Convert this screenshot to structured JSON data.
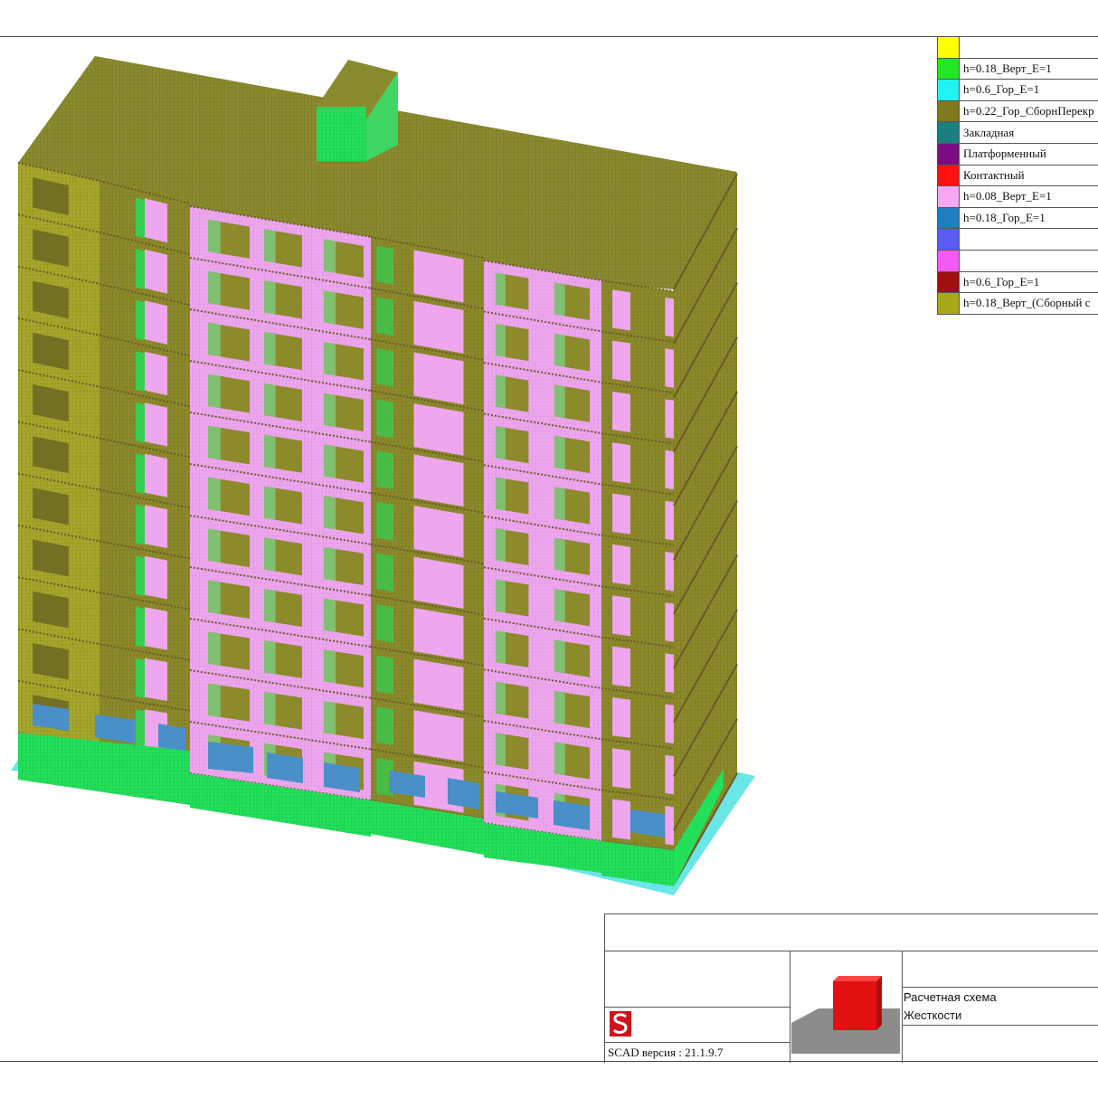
{
  "legend": {
    "items": [
      {
        "color": "#ffff00",
        "label": ""
      },
      {
        "color": "#22e822",
        "label": "h=0.18_Верт_E=1"
      },
      {
        "color": "#22f2f2",
        "label": "h=0.6_Гор_E=1"
      },
      {
        "color": "#807a1e",
        "label": "h=0.22_Гор_СборнПерекр"
      },
      {
        "color": "#1a7f80",
        "label": "Закладная"
      },
      {
        "color": "#7a0d82",
        "label": "Платформенный"
      },
      {
        "color": "#ff1111",
        "label": "Контактный"
      },
      {
        "color": "#f4a8f4",
        "label": "h=0.08_Верт_E=1"
      },
      {
        "color": "#1e7fc0",
        "label": "h=0.18_Гор_E=1"
      },
      {
        "color": "#5a5cf4",
        "label": ""
      },
      {
        "color": "#f55af5",
        "label": ""
      },
      {
        "color": "#a01010",
        "label": "h=0.6_Гор_E=1"
      },
      {
        "color": "#a8a81a",
        "label": "h=0.18_Верт_(Сборный с"
      }
    ]
  },
  "stamp": {
    "line1": "Расчетная схема",
    "line2": "Жесткости",
    "version": "SCAD версия : 21.1.9.7"
  },
  "colors": {
    "roof": "#8a8a2e",
    "wall_olive": "#8c8a2a",
    "pink": "#eea6ee",
    "green": "#22e05a",
    "cyan": "#6ae6e6",
    "blue": "#4a8fc8",
    "yellow_olive": "#a6a62a",
    "dark_olive": "#6e6a22"
  },
  "icons": [
    "scad-logo-icon",
    "building-preview-icon"
  ]
}
